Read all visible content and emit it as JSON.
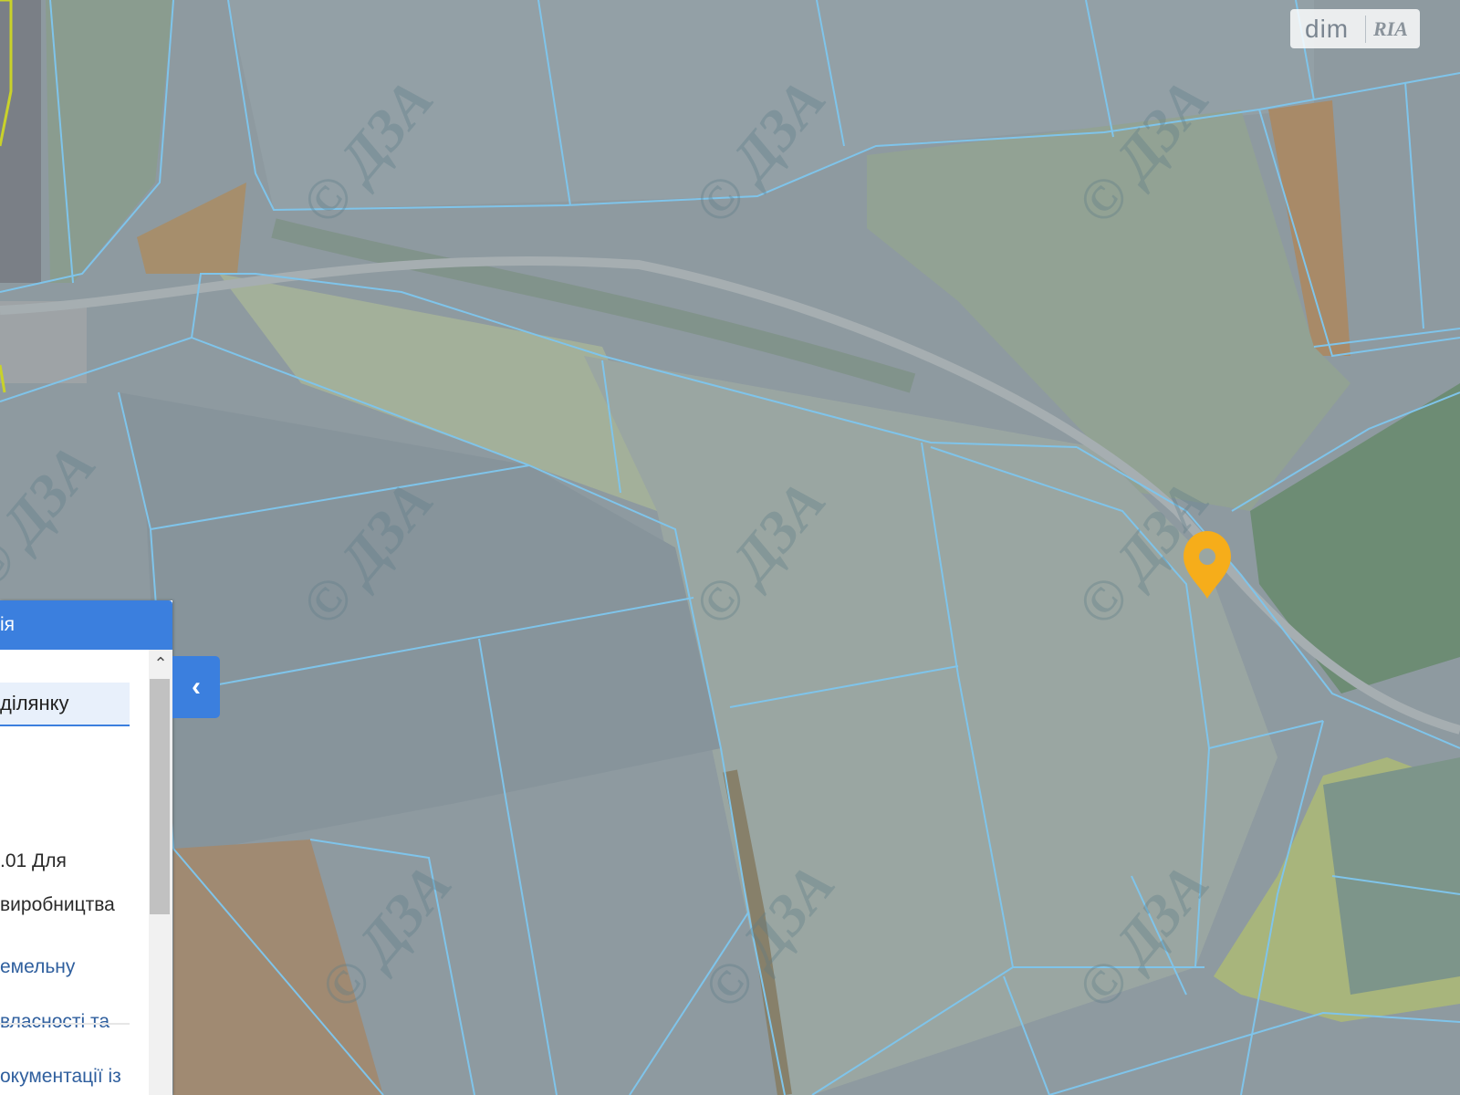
{
  "map": {
    "watermark_text": "© ДЗА",
    "colors": {
      "field_base": "#8e9aa0",
      "parcel_line": "#7fc4ea",
      "marker": "#f6ad1a",
      "green_area": "#6d8c74",
      "brown_field": "#a88a68",
      "yellow_outline": "#c9d22a"
    },
    "marker_icon": "map-pin-icon"
  },
  "logo": {
    "dim": "dim",
    "ria": "RIA"
  },
  "panel": {
    "header": "ія",
    "search_value": "ділянку",
    "row1": ".01 Для",
    "row2": "виробництва",
    "link1": "емельну",
    "link2": "власності та",
    "link3": "окументації із",
    "scroll_up_icon": "chevron-up-icon",
    "collapse_icon": "chevron-left-icon",
    "collapse_symbol": "‹"
  }
}
